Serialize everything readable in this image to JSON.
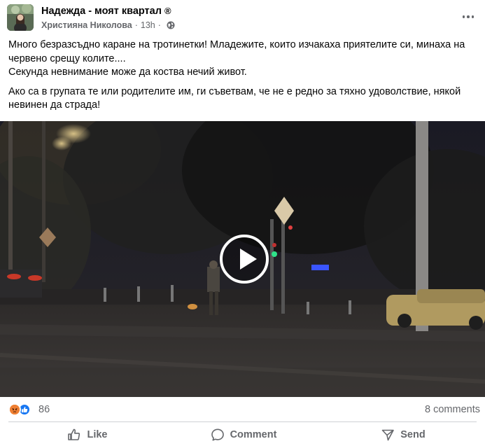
{
  "post": {
    "group_name": "Надежда - моят квартал",
    "group_badge": "®",
    "author": "Християна Николова",
    "separator": "·",
    "time": "13h",
    "audience_icon": "globe-icon",
    "text": {
      "p1_line1": "Много безразсъдно каране на тротинетки! Младежите, които изчакаха приятелите си, минаха на",
      "p1_line2": "червено срещу колите....",
      "p1_line3": "Секунда невнимание може да коства нечий живот.",
      "p2_line1": "Ако са в групата те или родителите им, ги съветвам, че не е редно за тяхно удоволствие, някой",
      "p2_line2": "невинен да страда!"
    }
  },
  "video": {
    "play_icon": "play-icon"
  },
  "reactions": {
    "icons": [
      "angry-icon",
      "like-icon"
    ],
    "count": "86",
    "comments": "8 comments"
  },
  "actions": {
    "like_label": "Like",
    "comment_label": "Comment",
    "send_label": "Send"
  },
  "colors": {
    "like_blue": "#1877f2",
    "angry_orange": "#e9710f",
    "secondary_text": "#65676b",
    "divider": "#ced0d4"
  }
}
